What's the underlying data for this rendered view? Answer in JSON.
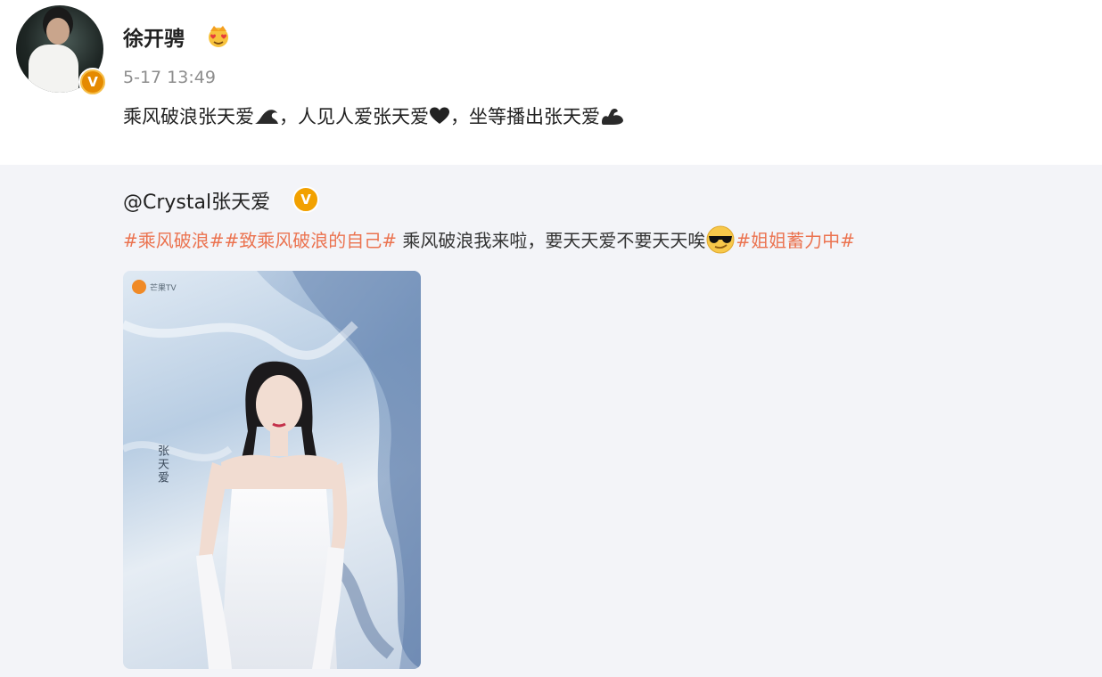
{
  "post": {
    "username": "徐开骋",
    "timestamp": "5-17 13:49",
    "text_part1": "乘风破浪张天爱",
    "text_part2": "，人见人爱张天爱",
    "text_part3": "，坐等播出张天爱",
    "badge": "V",
    "icons": [
      "wave-emoji",
      "black-heart-emoji",
      "flexed-biceps-emoji",
      "crown-heart-eyes-icon"
    ]
  },
  "repost": {
    "at_user": "@Crystal张天爱",
    "badge": "V",
    "tag1": "#乘风破浪#",
    "tag2": "#致乘风破浪的自己#",
    "text": " 乘风破浪我来啦，要天天爱不要天天唉",
    "tag3": "#姐姐蓄力中#",
    "icons": [
      "sunglasses-emoji"
    ],
    "image": {
      "logo_text": "芒果TV",
      "vertical_text": "张天爱"
    }
  },
  "colors": {
    "tag": "#eb7350",
    "badge": "#f2a100",
    "repost_bg": "#f3f4f8",
    "timestamp": "#8d8d8d"
  }
}
